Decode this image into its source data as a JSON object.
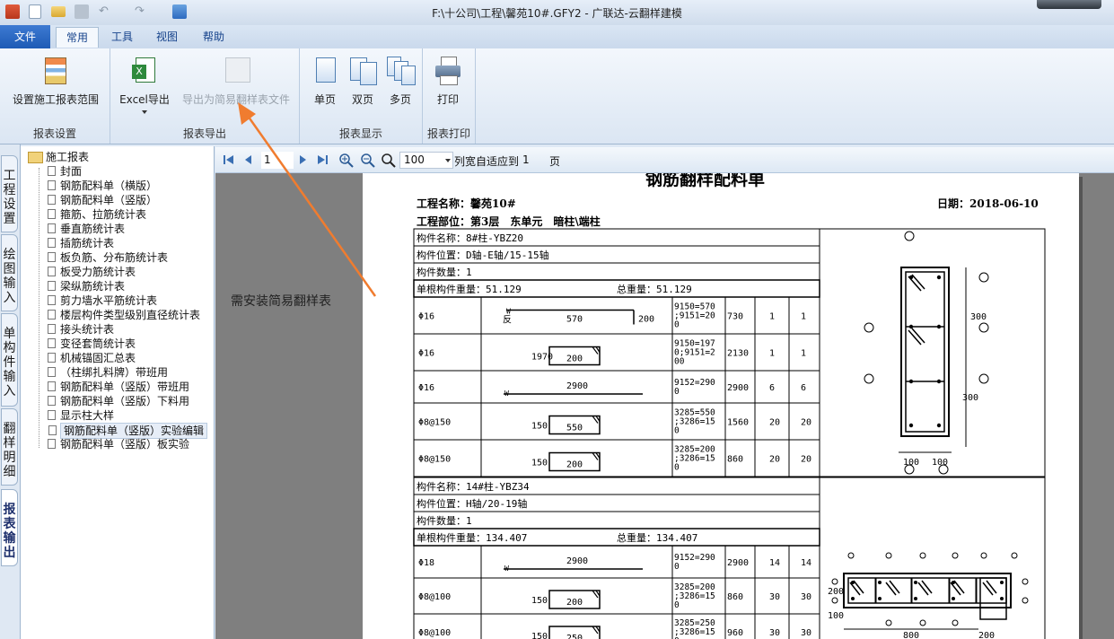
{
  "app": {
    "title": "F:\\十公司\\工程\\馨苑10#.GFY2 - 广联达-云翻样建模"
  },
  "menu": {
    "file": "文件",
    "tabs": [
      "常用",
      "工具",
      "视图",
      "帮助"
    ]
  },
  "ribbon": {
    "groups": [
      {
        "label": "报表设置",
        "buttons": [
          "设置施工报表范围"
        ]
      },
      {
        "label": "报表导出",
        "buttons": [
          "Excel导出",
          "导出为简易翻样表文件"
        ]
      },
      {
        "label": "报表显示",
        "buttons": [
          "单页",
          "双页",
          "多页"
        ]
      },
      {
        "label": "报表打印",
        "buttons": [
          "打印"
        ]
      }
    ]
  },
  "side_tabs": [
    "工程设置",
    "绘图输入",
    "单构件输入",
    "翻样明细",
    "报表输出"
  ],
  "tree": {
    "root": "施工报表",
    "items": [
      "封面",
      "钢筋配料单（横版）",
      "钢筋配料单（竖版）",
      "箍筋、拉筋统计表",
      "垂直筋统计表",
      "插筋统计表",
      "板负筋、分布筋统计表",
      "板受力筋统计表",
      "梁纵筋统计表",
      "剪力墙水平筋统计表",
      "楼层构件类型级别直径统计表",
      "接头统计表",
      "变径套筒统计表",
      "机械锚固汇总表",
      "（柱绑扎料牌）带班用",
      "钢筋配料单（竖版）带班用",
      "钢筋配料单（竖版）下料用",
      "显示柱大样",
      "钢筋配料单（竖版）实验编辑",
      "钢筋配料单（竖版）板实验"
    ]
  },
  "preview_toolbar": {
    "page": "1",
    "zoom": "100",
    "fit_label": "列宽自适应到",
    "fit_value": "1",
    "page_unit": "页"
  },
  "annotation": "需安装简易翻样表",
  "report": {
    "title": "钢筋翻样配料单",
    "project_name": "工程名称：馨苑10#",
    "date": "日期：2018-06-10",
    "location": "工程部位：第3层　东单元　暗柱\\端柱",
    "blocks": [
      {
        "name": "构件名称：8#柱-YBZ20",
        "position": "构件位置：D轴-E轴/15-15轴",
        "count": "构件数量：1",
        "unit_weight": "单根构件重量：51.129",
        "total_weight": "总重量：51.129",
        "rows": [
          {
            "grade": "Φ16",
            "dims": [
              "570",
              "200"
            ],
            "calc": [
              "9150=570",
              ";9151=20",
              "0"
            ],
            "len": "730",
            "a": "1",
            "b": "1"
          },
          {
            "grade": "Φ16",
            "dims": [
              "1970",
              "200"
            ],
            "calc": [
              "9150=197",
              "0;9151=2",
              "00"
            ],
            "len": "2130",
            "a": "1",
            "b": "1"
          },
          {
            "grade": "Φ16",
            "dims": [
              "2900"
            ],
            "calc": [
              "9152=290",
              "0"
            ],
            "len": "2900",
            "a": "6",
            "b": "6"
          },
          {
            "grade": "Φ8@150",
            "dims": [
              "150",
              "550"
            ],
            "calc": [
              "3285=550",
              ";3286=15",
              "0"
            ],
            "len": "1560",
            "a": "20",
            "b": "20"
          },
          {
            "grade": "Φ8@150",
            "dims": [
              "150",
              "200"
            ],
            "calc": [
              "3285=200",
              ";3286=15",
              "0"
            ],
            "len": "860",
            "a": "20",
            "b": "20"
          }
        ],
        "section_labels": [
          "300",
          "300",
          "100",
          "100"
        ]
      },
      {
        "name": "构件名称：14#柱-YBZ34",
        "position": "构件位置：H轴/20-19轴",
        "count": "构件数量：1",
        "unit_weight": "单根构件重量：134.407",
        "total_weight": "总重量：134.407",
        "rows": [
          {
            "grade": "Φ18",
            "dims": [
              "2900"
            ],
            "calc": [
              "9152=290",
              "0"
            ],
            "len": "2900",
            "a": "14",
            "b": "14"
          },
          {
            "grade": "Φ8@100",
            "dims": [
              "150",
              "200"
            ],
            "calc": [
              "3285=200",
              ";3286=15",
              "0"
            ],
            "len": "860",
            "a": "30",
            "b": "30"
          },
          {
            "grade": "Φ8@100",
            "dims": [
              "150",
              "250"
            ],
            "calc": [
              "3285=250",
              ";3286=15",
              "0"
            ],
            "len": "960",
            "a": "30",
            "b": "30"
          }
        ],
        "section_labels": [
          "200",
          "100",
          "800",
          "200"
        ]
      }
    ],
    "bend_marks": [
      "W",
      "反"
    ]
  }
}
